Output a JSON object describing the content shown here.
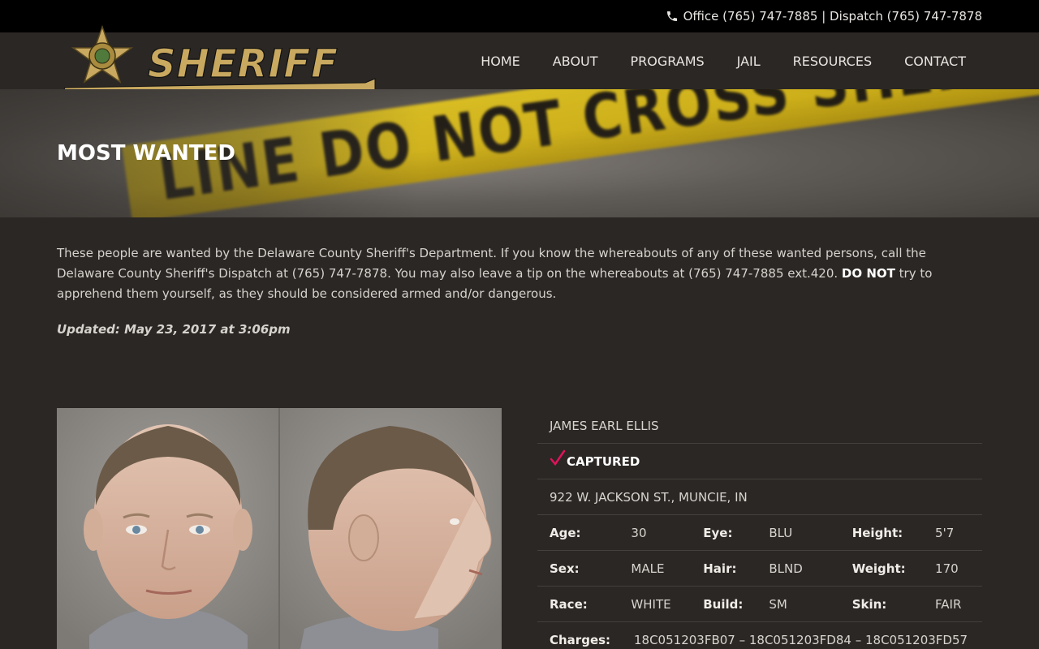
{
  "topbar": {
    "contact_text": "Office (765) 747-7885 | Dispatch (765) 747-7878",
    "phone_icon": "phone-icon"
  },
  "header": {
    "logo_text": "SHERIFF",
    "nav": [
      {
        "label": "HOME"
      },
      {
        "label": "ABOUT"
      },
      {
        "label": "PROGRAMS"
      },
      {
        "label": "JAIL"
      },
      {
        "label": "RESOURCES"
      },
      {
        "label": "CONTACT"
      }
    ]
  },
  "banner": {
    "title": "MOST WANTED",
    "tape_text": "LINE DO NOT CROSS  SHERIFF LINE DO"
  },
  "intro": {
    "part1": "These people are wanted by the Delaware County Sheriff's Department.  If you know the whereabouts of any of these wanted persons, call the Delaware County Sheriff's Dispatch at (765) 747-7878.  You may also leave a tip on the whereabouts at (765) 747-7885 ext.420.  ",
    "bold": "DO NOT",
    "part2": " try to apprehend them yourself, as they should be considered armed and/or dangerous.",
    "updated": "Updated: May 23, 2017 at 3:06pm"
  },
  "wanted": {
    "name": "JAMES EARL ELLIS",
    "status": "CAPTURED",
    "status_color": "#e0135c",
    "address": "922 W. JACKSON ST., MUNCIE, IN",
    "details": {
      "age_label": "Age:",
      "age": "30",
      "eye_label": "Eye:",
      "eye": "BLU",
      "height_label": "Height:",
      "height": "5'7",
      "sex_label": "Sex:",
      "sex": "MALE",
      "hair_label": "Hair:",
      "hair": "BLND",
      "weight_label": "Weight:",
      "weight": "170",
      "race_label": "Race:",
      "race": "WHITE",
      "build_label": "Build:",
      "build": "SM",
      "skin_label": "Skin:",
      "skin": "FAIR",
      "charges_label": "Charges:",
      "charges": "18C051203FB07 – 18C051203FD84 – 18C051203FD57"
    }
  }
}
